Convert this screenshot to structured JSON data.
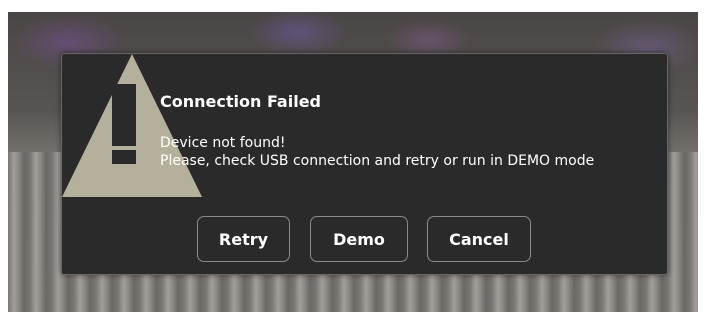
{
  "dialog": {
    "title": "Connection Failed",
    "message_line1": "Device not found!",
    "message_line2": "Please, check USB connection and retry or run in DEMO mode",
    "icon": "warning-icon"
  },
  "buttons": {
    "retry_label": "Retry",
    "demo_label": "Demo",
    "cancel_label": "Cancel"
  },
  "colors": {
    "dialog_bg": "#2b2a2a",
    "warning_triangle": "#b5b09c",
    "text": "#ffffff"
  }
}
